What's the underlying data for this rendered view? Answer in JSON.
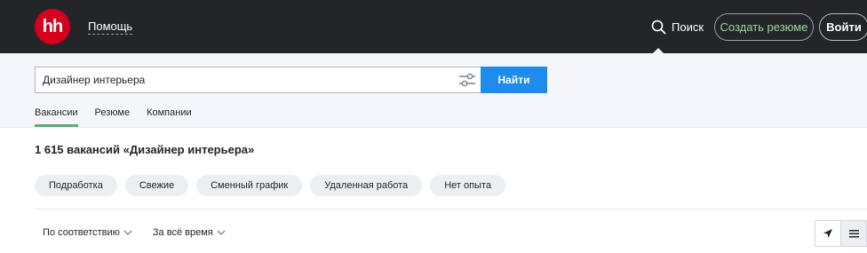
{
  "header": {
    "logo_text": "hh",
    "help_label": "Помощь",
    "search_label": "Поиск",
    "create_resume_label": "Создать резюме",
    "login_label": "Войти"
  },
  "search": {
    "query": "Дизайнер интерьера",
    "find_label": "Найти",
    "tabs": [
      {
        "label": "Вакансии",
        "active": true
      },
      {
        "label": "Резюме",
        "active": false
      },
      {
        "label": "Компании",
        "active": false
      }
    ]
  },
  "results": {
    "title": "1 615 вакансий «Дизайнер интерьера»",
    "chips": [
      "Подработка",
      "Свежие",
      "Сменный график",
      "Удаленная работа",
      "Нет опыта"
    ],
    "sort_relevance": "По соответствию",
    "sort_period": "За всё время"
  },
  "colors": {
    "header_bg": "#232529",
    "logo_red": "#d6001c",
    "accent_blue": "#1f8ceb",
    "tab_active": "#62a87c",
    "create_text": "#9bd79e"
  },
  "icons": [
    "search-icon",
    "filters-icon",
    "chevron-down-icon",
    "location-arrow-icon",
    "list-view-icon"
  ]
}
